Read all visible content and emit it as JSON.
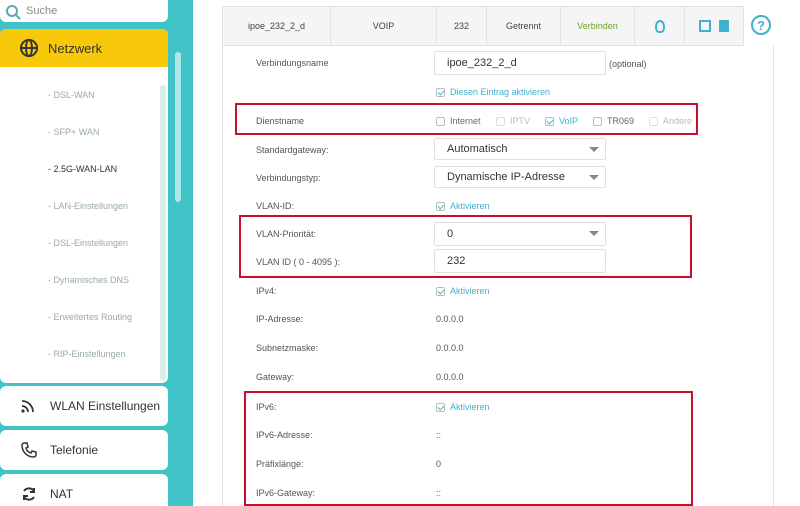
{
  "sidebar": {
    "search_placeholder": "Suche",
    "network": {
      "label": "Netzwerk",
      "items": [
        {
          "label": "- DSL-WAN",
          "active": false
        },
        {
          "label": "- SFP+ WAN",
          "active": false
        },
        {
          "label": "- 2.5G-WAN-LAN",
          "active": true
        },
        {
          "label": "- LAN-Einstellungen",
          "active": false
        },
        {
          "label": "- DSL-Einstellungen",
          "active": false
        },
        {
          "label": "- Dynamisches DNS",
          "active": false
        },
        {
          "label": "- Erweitertes Routing",
          "active": false
        },
        {
          "label": "- RIP-Einstellungen",
          "active": false
        }
      ]
    },
    "menu": [
      {
        "label": "WLAN Einstellungen",
        "icon": "wifi-icon"
      },
      {
        "label": "Telefonie",
        "icon": "phone-icon"
      },
      {
        "label": "NAT",
        "icon": "nat-icon"
      }
    ]
  },
  "table": {
    "name": "ipoe_232_2_d",
    "service": "VOIP",
    "vlan": "232",
    "status": "Getrennt",
    "action": "Verbinden"
  },
  "form": {
    "connection_name_label": "Verbindungsname",
    "connection_name_value": "ipoe_232_2_d",
    "optional": "(optional)",
    "enable_entry": "Diesen Eintrag aktivieren",
    "service_name_label": "Dienstname",
    "services": [
      {
        "label": "Internet",
        "checked": false
      },
      {
        "label": "IPTV",
        "checked": false
      },
      {
        "label": "VoIP",
        "checked": true
      },
      {
        "label": "TR069",
        "checked": false
      },
      {
        "label": "Andere",
        "checked": false
      }
    ],
    "default_gateway_label": "Standardgateway:",
    "default_gateway_value": "Automatisch",
    "connection_type_label": "Verbindungstyp:",
    "connection_type_value": "Dynamische IP-Adresse",
    "vlan_id_label": "VLAN-ID:",
    "vlan_id_check": "Aktivieren",
    "vlan_priority_label": "VLAN-Priorität:",
    "vlan_priority_value": "0",
    "vlan_id_range_label": "VLAN ID ( 0 - 4095 ):",
    "vlan_id_value": "232",
    "ipv4_label": "IPv4:",
    "ipv4_check": "Aktivieren",
    "ip_address_label": "IP-Adresse:",
    "ip_address_value": "0.0.0.0",
    "subnet_label": "Subnetzmaske:",
    "subnet_value": "0.0.0.0",
    "gateway_label": "Gateway:",
    "gateway_value": "0.0.0.0",
    "ipv6_label": "IPv6:",
    "ipv6_check": "Aktivieren",
    "ipv6_address_label": "IPv6-Adresse:",
    "ipv6_address_value": "::",
    "prefix_label": "Präfixlänge:",
    "prefix_value": "0",
    "ipv6_gateway_label": "IPv6-Gateway:",
    "ipv6_gateway_value": "::"
  },
  "colors": {
    "accent": "#3fb0ce",
    "brand_yellow": "#f7c90a",
    "highlight_red": "#c8102e",
    "teal_bg": "#3fc3c7"
  }
}
